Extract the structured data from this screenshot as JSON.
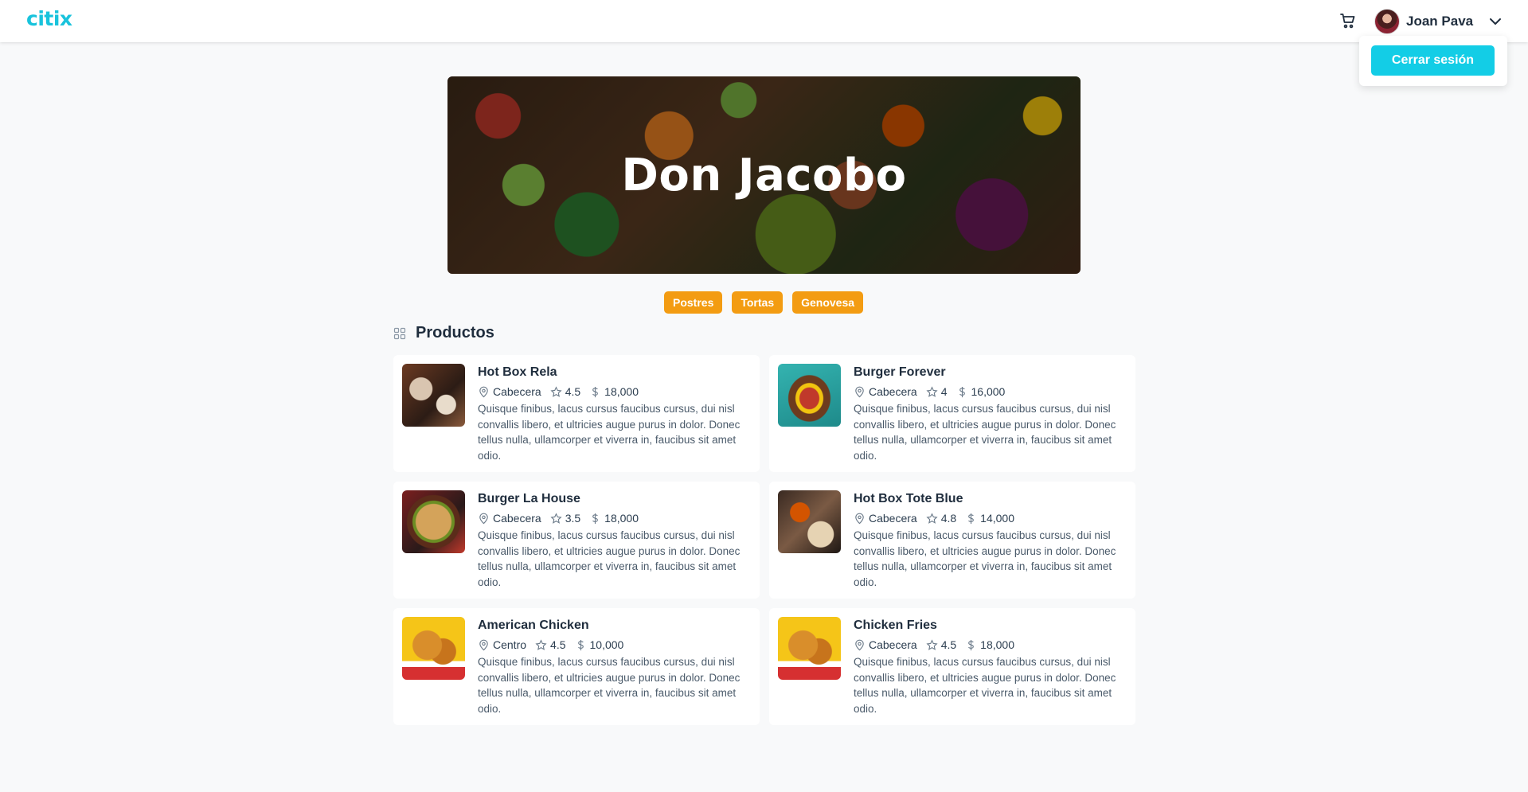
{
  "header": {
    "logo": "citix",
    "user_name": "Joan Pava",
    "icons": [
      "cart-icon",
      "chevron-down-icon"
    ]
  },
  "dropdown": {
    "logout_label": "Cerrar sesión"
  },
  "banner": {
    "title": "Don Jacobo"
  },
  "tags": [
    "Postres",
    "Tortas",
    "Genovesa"
  ],
  "section": {
    "title": "Productos",
    "icon": "grid-icon"
  },
  "products": [
    {
      "name": "Hot Box Rela",
      "location": "Cabecera",
      "rating": "4.5",
      "price": "18,000",
      "description": "Quisque finibus, lacus cursus faucibus cursus, dui nisl convallis libero, et ultricies augue purus in dolor. Donec tellus nulla, ullamcorper et viverra in, faucibus sit amet odio."
    },
    {
      "name": "Burger Forever",
      "location": "Cabecera",
      "rating": "4",
      "price": "16,000",
      "description": "Quisque finibus, lacus cursus faucibus cursus, dui nisl convallis libero, et ultricies augue purus in dolor. Donec tellus nulla, ullamcorper et viverra in, faucibus sit amet odio."
    },
    {
      "name": "Burger La House",
      "location": "Cabecera",
      "rating": "3.5",
      "price": "18,000",
      "description": "Quisque finibus, lacus cursus faucibus cursus, dui nisl convallis libero, et ultricies augue purus in dolor. Donec tellus nulla, ullamcorper et viverra in, faucibus sit amet odio."
    },
    {
      "name": "Hot Box Tote Blue",
      "location": "Cabecera",
      "rating": "4.8",
      "price": "14,000",
      "description": "Quisque finibus, lacus cursus faucibus cursus, dui nisl convallis libero, et ultricies augue purus in dolor. Donec tellus nulla, ullamcorper et viverra in, faucibus sit amet odio."
    },
    {
      "name": "American Chicken",
      "location": "Centro",
      "rating": "4.5",
      "price": "10,000",
      "description": "Quisque finibus, lacus cursus faucibus cursus, dui nisl convallis libero, et ultricies augue purus in dolor. Donec tellus nulla, ullamcorper et viverra in, faucibus sit amet odio."
    },
    {
      "name": "Chicken Fries",
      "location": "Cabecera",
      "rating": "4.5",
      "price": "18,000",
      "description": "Quisque finibus, lacus cursus faucibus cursus, dui nisl convallis libero, et ultricies augue purus in dolor. Donec tellus nulla, ullamcorper et viverra in, faucibus sit amet odio."
    }
  ],
  "colors": {
    "accent": "#13cde6",
    "tag": "#f39c12",
    "logo": "#19c3dc"
  }
}
